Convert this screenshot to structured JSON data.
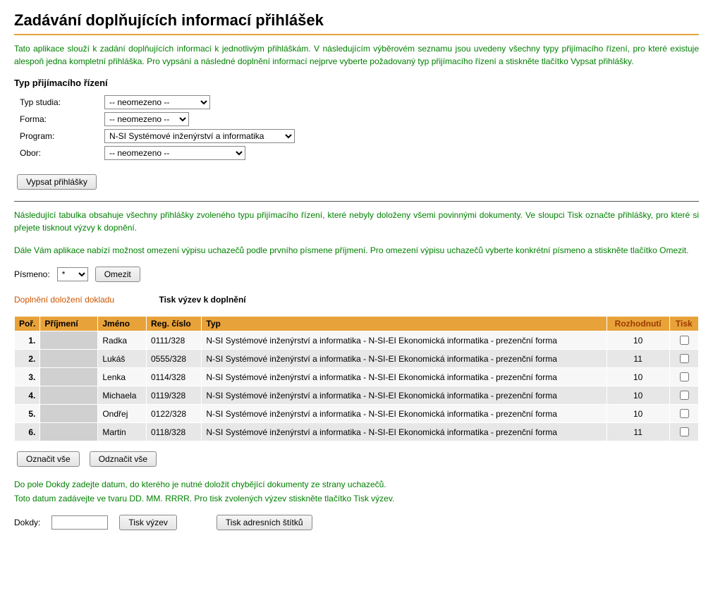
{
  "page_title": "Zadávání doplňujících informací přihlášek",
  "intro": "Tato aplikace slouží k zadání doplňujících informací k jednotlivým přihláškám. V následujícím výběrovém seznamu jsou uvedeny všechny typy přijímacího řízení, pro které existuje alespoň jedna kompletní přihláška. Pro vypsání a následné doplnění informací nejprve vyberte požadovaný typ přijímacího řízení a stiskněte tlačítko Vypsat přihlášky.",
  "filter_section_title": "Typ přijímacího řízení",
  "fields": {
    "typ_studia": {
      "label": "Typ studia:",
      "value": "-- neomezeno --"
    },
    "forma": {
      "label": "Forma:",
      "value": "-- neomezeno --"
    },
    "program": {
      "label": "Program:",
      "value": "N-SI Systémové inženýrství a informatika"
    },
    "obor": {
      "label": "Obor:",
      "value": "-- neomezeno --"
    }
  },
  "buttons": {
    "vypsat": "Vypsat přihlášky",
    "omezit": "Omezit",
    "oznacit_vse": "Označit vše",
    "odznacit_vse": "Odznačit vše",
    "tisk_vyzev": "Tisk výzev",
    "tisk_stitku": "Tisk adresních štítků"
  },
  "mid_text_1": "Následující tabulka obsahuje všechny přihlášky zvoleného typu přijímacího řízení, které nebyly doloženy všemi povinnými dokumenty. Ve sloupci Tisk označte přihlášky, pro které si přejete tisknout výzvy k dopnění.",
  "mid_text_2": "Dále Vám aplikace nabízí možnost omezení výpisu uchazečů podle prvního písmene příjmení. Pro omezení výpisu uchazečů vyberte konkrétní písmeno a stiskněte tlačítko Omezit.",
  "letter_filter": {
    "label": "Písmeno:",
    "value": "*"
  },
  "tabs": {
    "inactive": "Doplnění doložení dokladu",
    "active": "Tisk výzev k doplnění"
  },
  "table": {
    "headers": {
      "por": "Poř.",
      "prijmeni": "Příjmení",
      "jmeno": "Jméno",
      "regcislo": "Reg. číslo",
      "typ": "Typ",
      "rozhodnuti": "Rozhodnutí",
      "tisk": "Tisk"
    },
    "rows": [
      {
        "por": "1.",
        "jmeno": "Radka",
        "reg": "0111/328",
        "typ": "N-SI Systémové inženýrství a informatika - N-SI-EI Ekonomická informatika - prezenční forma",
        "rozh": "10"
      },
      {
        "por": "2.",
        "jmeno": "Lukáš",
        "reg": "0555/328",
        "typ": "N-SI Systémové inženýrství a informatika - N-SI-EI Ekonomická informatika - prezenční forma",
        "rozh": "11"
      },
      {
        "por": "3.",
        "jmeno": "Lenka",
        "reg": "0114/328",
        "typ": "N-SI Systémové inženýrství a informatika - N-SI-EI Ekonomická informatika - prezenční forma",
        "rozh": "10"
      },
      {
        "por": "4.",
        "jmeno": "Michaela",
        "reg": "0119/328",
        "typ": "N-SI Systémové inženýrství a informatika - N-SI-EI Ekonomická informatika - prezenční forma",
        "rozh": "10"
      },
      {
        "por": "5.",
        "jmeno": "Ondřej",
        "reg": "0122/328",
        "typ": "N-SI Systémové inženýrství a informatika - N-SI-EI Ekonomická informatika - prezenční forma",
        "rozh": "10"
      },
      {
        "por": "6.",
        "jmeno": "Martin",
        "reg": "0118/328",
        "typ": "N-SI Systémové inženýrství a informatika - N-SI-EI Ekonomická informatika - prezenční forma",
        "rozh": "11"
      }
    ]
  },
  "bottom_text_1": "Do pole Dokdy zadejte datum, do kterého je nutné doložit chybějící dokumenty ze strany uchazečů.",
  "bottom_text_2": "Toto datum zadávejte ve tvaru DD. MM. RRRR. Pro tisk zvolených výzev stiskněte tlačítko Tisk výzev.",
  "dokdy_label": "Dokdy:"
}
